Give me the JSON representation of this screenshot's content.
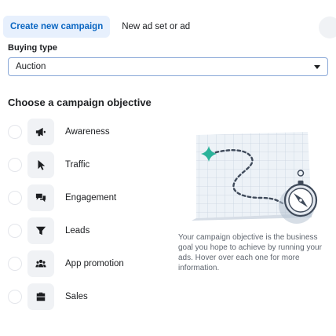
{
  "tabs": {
    "create_new_campaign": "Create new campaign",
    "new_ad_set_or_ad": "New ad set or ad"
  },
  "buying_type": {
    "label": "Buying type",
    "selected": "Auction"
  },
  "objective_section": {
    "title": "Choose a campaign objective",
    "items": [
      {
        "label": "Awareness",
        "icon": "megaphone-icon"
      },
      {
        "label": "Traffic",
        "icon": "cursor-icon"
      },
      {
        "label": "Engagement",
        "icon": "chat-bubbles-icon"
      },
      {
        "label": "Leads",
        "icon": "funnel-icon"
      },
      {
        "label": "App promotion",
        "icon": "people-icon"
      },
      {
        "label": "Sales",
        "icon": "briefcase-icon"
      }
    ],
    "description": "Your campaign objective is the business goal you hope to achieve by running your ads. Hover over each one for more information."
  },
  "colors": {
    "accent": "#0a66c2",
    "accent_bg": "#e7f0fd",
    "map_green": "#2bb39a"
  }
}
